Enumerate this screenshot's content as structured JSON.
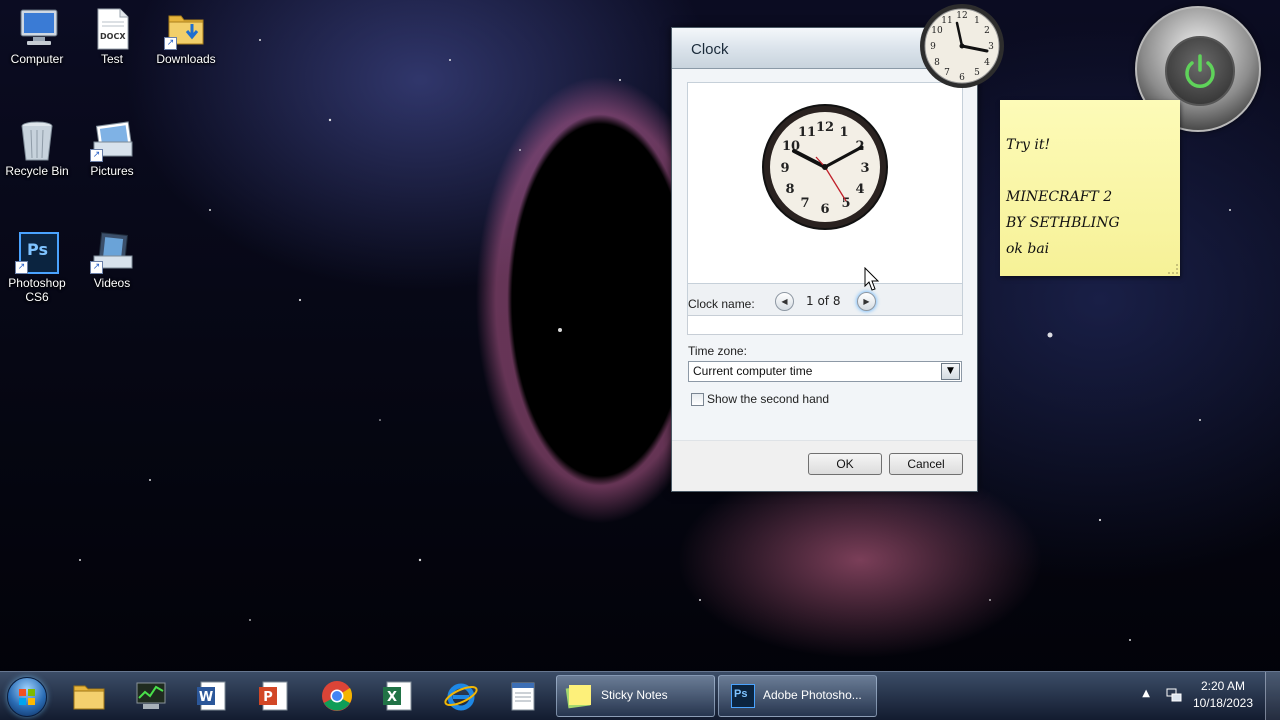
{
  "desktop": {
    "icons": [
      {
        "label": "Computer"
      },
      {
        "label": "Test",
        "badge": "DOCX"
      },
      {
        "label": "Downloads"
      },
      {
        "label": "Recycle Bin"
      },
      {
        "label": "Pictures"
      },
      {
        "label": "Photoshop CS6",
        "line1": "Photoshop",
        "line2": "CS6",
        "badge": "Ps"
      },
      {
        "label": "Videos"
      }
    ]
  },
  "dialog": {
    "title": "Clock",
    "pager": {
      "text": "1 of 8",
      "prev_icon": "left-arrow-icon",
      "next_icon": "right-arrow-icon"
    },
    "clock_name_label": "Clock name:",
    "clock_name_value": "",
    "timezone_label": "Time zone:",
    "timezone_value": "Current computer time",
    "second_hand_label": "Show the second hand",
    "second_hand_checked": false,
    "ok_label": "OK",
    "cancel_label": "Cancel"
  },
  "sticky_note": {
    "lines": [
      "Try it!",
      "MINECRAFT 2",
      "BY SETHBLING",
      "ok bai"
    ]
  },
  "taskbar": {
    "pinned": [
      "start-orb",
      "explorer",
      "task-manager",
      "word",
      "powerpoint",
      "chrome",
      "excel",
      "internet-explorer",
      "notepad"
    ],
    "tasks": [
      {
        "label": "Sticky Notes"
      },
      {
        "label": "Adobe Photosho...",
        "badge": "Ps"
      }
    ],
    "clock": {
      "time": "2:20 AM",
      "date": "10/18/2023"
    }
  },
  "colors": {
    "accent": "#2b6db5",
    "sticky": "#f6f197",
    "power_green": "#5fd35a"
  }
}
